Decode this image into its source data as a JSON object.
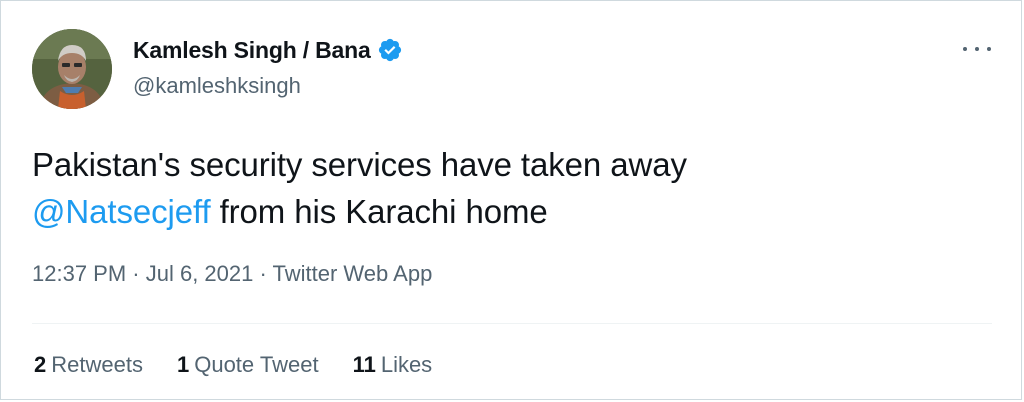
{
  "author": {
    "display_name": "Kamlesh Singh / Bana",
    "handle": "@kamleshksingh",
    "verified": true
  },
  "tweet": {
    "text_before_mention": "Pakistan's security services have taken away",
    "mention": "@Natsecjeff",
    "text_after_mention": " from his Karachi home"
  },
  "meta": {
    "time": "12:37 PM",
    "separator1": " · ",
    "date": "Jul 6, 2021",
    "separator2": " · ",
    "source": "Twitter Web App"
  },
  "stats": {
    "retweets_count": "2",
    "retweets_label": "Retweets",
    "quotes_count": "1",
    "quotes_label": "Quote Tweet",
    "likes_count": "11",
    "likes_label": "Likes"
  },
  "icons": {
    "verified": "verified-badge-icon",
    "more": "more-options-icon"
  },
  "colors": {
    "link": "#1d9bf0",
    "secondary_text": "#536471",
    "primary_text": "#0f1419",
    "border": "#cfd9de"
  }
}
